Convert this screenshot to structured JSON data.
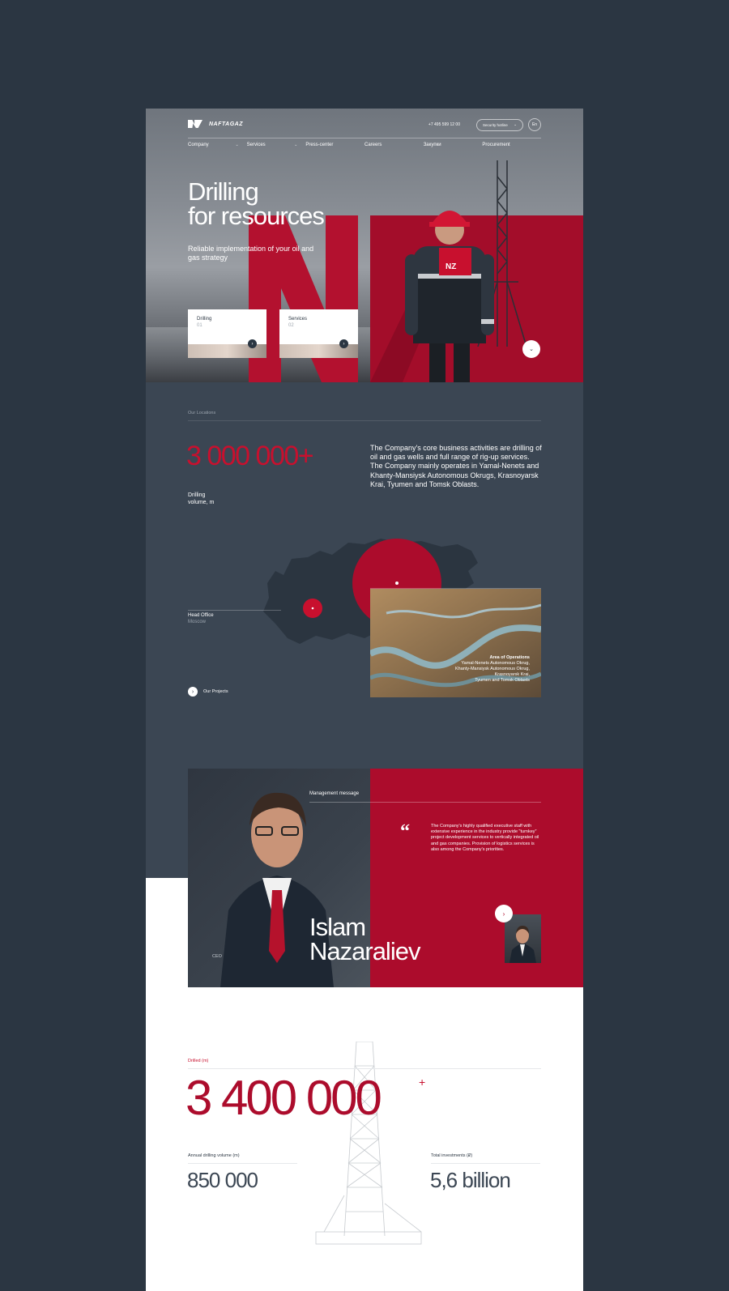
{
  "header": {
    "logo_mark": "NZ",
    "logo_text": "NAFTAGAZ",
    "phone": "+7 495 599 12 00",
    "hotline_label": "Security hotline",
    "hotline_caret": "⌄",
    "lang": "En"
  },
  "nav": [
    {
      "label": "Company",
      "caret": "⌄"
    },
    {
      "label": "Services",
      "caret": "⌄"
    },
    {
      "label": "Press-center",
      "caret": ""
    },
    {
      "label": "Careers",
      "caret": ""
    },
    {
      "label": "Закупки",
      "caret": ""
    },
    {
      "label": "Procurement",
      "caret": ""
    }
  ],
  "hero": {
    "title_line1": "Drilling",
    "title_line2": "for resources",
    "subtitle": "Reliable implementation of your oil and gas strategy",
    "cards": [
      {
        "title": "Drilling",
        "number": "01"
      },
      {
        "title": "Services",
        "number": "02"
      }
    ],
    "scroll_icon": "⌄"
  },
  "locations": {
    "label": "Our Locations",
    "big_value": "3 000 000+",
    "big_value_label_1": "Drilling",
    "big_value_label_2": "volume, m",
    "description": "The Company's core business activities are drilling of oil and gas wells and full range of rig-up services. The Company mainly operates in Yamal-Nenets and Khanty-Mansiysk Autonomous Okrugs, Krasnoyarsk Krai, Tyumen and Tomsk Oblasts.",
    "head_office_title": "Head Office",
    "head_office_city": "Moscow",
    "area_title": "Area of Operations",
    "area_lines": [
      "Yamal-Nenets Autonomous Okrug,",
      "Khanty-Mansiysk Autonomous Okrug,",
      "Krasnoyarsk Krai,",
      "Tyumen and Tomsk Oblasts"
    ],
    "projects_label": "Our Projects",
    "projects_icon": "›"
  },
  "management": {
    "label": "Management message",
    "quote_mark": "“",
    "quote": "The Company's highly qualified executive staff with extensive experience in the industry provide \"turnkey\" project development services to vertically integrated oil and gas companies. Provision of logistics services is also among the Company's priorities.",
    "name_line1": "Islam",
    "name_line2": "Nazaraliev",
    "role": "CEO",
    "next_icon": "›"
  },
  "stats": {
    "drilled_label": "Drilled (m)",
    "drilled_value": "3 400 000",
    "drilled_plus": "+",
    "annual_label": "Annual drilling volume (m)",
    "annual_value": "850 000",
    "invest_label": "Total investments (₽)",
    "invest_value": "5,6 billion"
  },
  "colors": {
    "background": "#2b3642",
    "panel": "#3b4653",
    "accent_red": "#c8102e",
    "deep_red": "#ac0c2c"
  }
}
